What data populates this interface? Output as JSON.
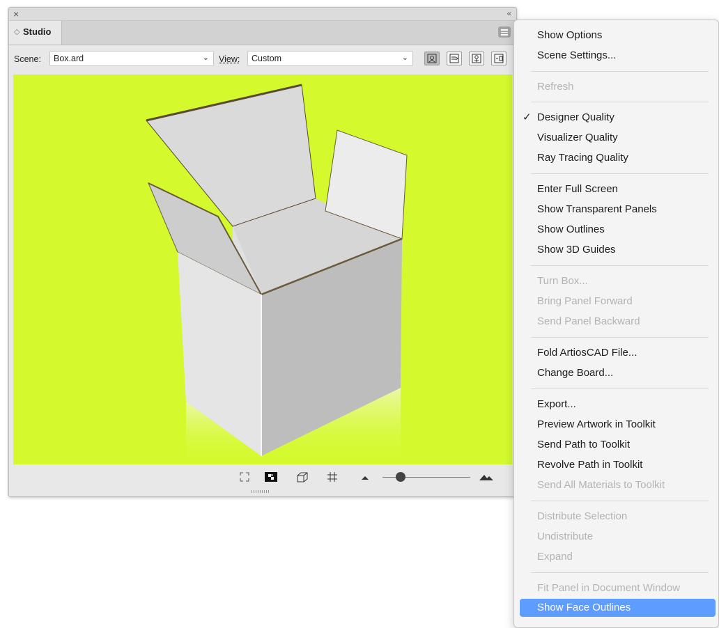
{
  "panel": {
    "close_glyph": "×",
    "collapse_glyph": "‹‹",
    "tab_label": "Studio"
  },
  "toolbar": {
    "scene_label": "Scene:",
    "scene_value": "Box.ard",
    "view_label": "View:",
    "view_value": "Custom",
    "view_buttons": [
      "view-mode-1-icon",
      "view-mode-2-icon",
      "view-mode-3-icon",
      "view-mode-4-icon"
    ]
  },
  "viewport": {
    "background_color": "#d4fa2e",
    "content": "open-3d-box"
  },
  "bottom_bar": {
    "icons": [
      "fit-to-view-icon",
      "checker-icon",
      "box-3d-icon",
      "grid-icon",
      "small-mountain-icon",
      "large-mountain-icon"
    ],
    "zoom_level_fraction": 0.2
  },
  "context_menu": {
    "show_options": "Show Options",
    "scene_settings": "Scene Settings...",
    "refresh": "Refresh",
    "designer_quality": "Designer Quality",
    "designer_check": "✓",
    "visualizer_quality": "Visualizer Quality",
    "ray_tracing_quality": "Ray Tracing Quality",
    "enter_full_screen": "Enter Full Screen",
    "show_transparent_panels": "Show Transparent Panels",
    "show_outlines": "Show Outlines",
    "show_3d_guides": "Show 3D Guides",
    "turn_box": "Turn Box...",
    "bring_panel_forward": "Bring Panel Forward",
    "send_panel_backward": "Send Panel Backward",
    "fold_artioscad": "Fold ArtiosCAD File...",
    "change_board": "Change Board...",
    "export": "Export...",
    "preview_artwork": "Preview Artwork in Toolkit",
    "send_path": "Send Path to Toolkit",
    "revolve_path": "Revolve Path in Toolkit",
    "send_all_materials": "Send All Materials to Toolkit",
    "distribute_selection": "Distribute Selection",
    "undistribute": "Undistribute",
    "expand": "Expand",
    "fit_panel": "Fit Panel in Document Window",
    "show_face_outlines": "Show Face Outlines",
    "highlight_color": "#5e9cff"
  }
}
